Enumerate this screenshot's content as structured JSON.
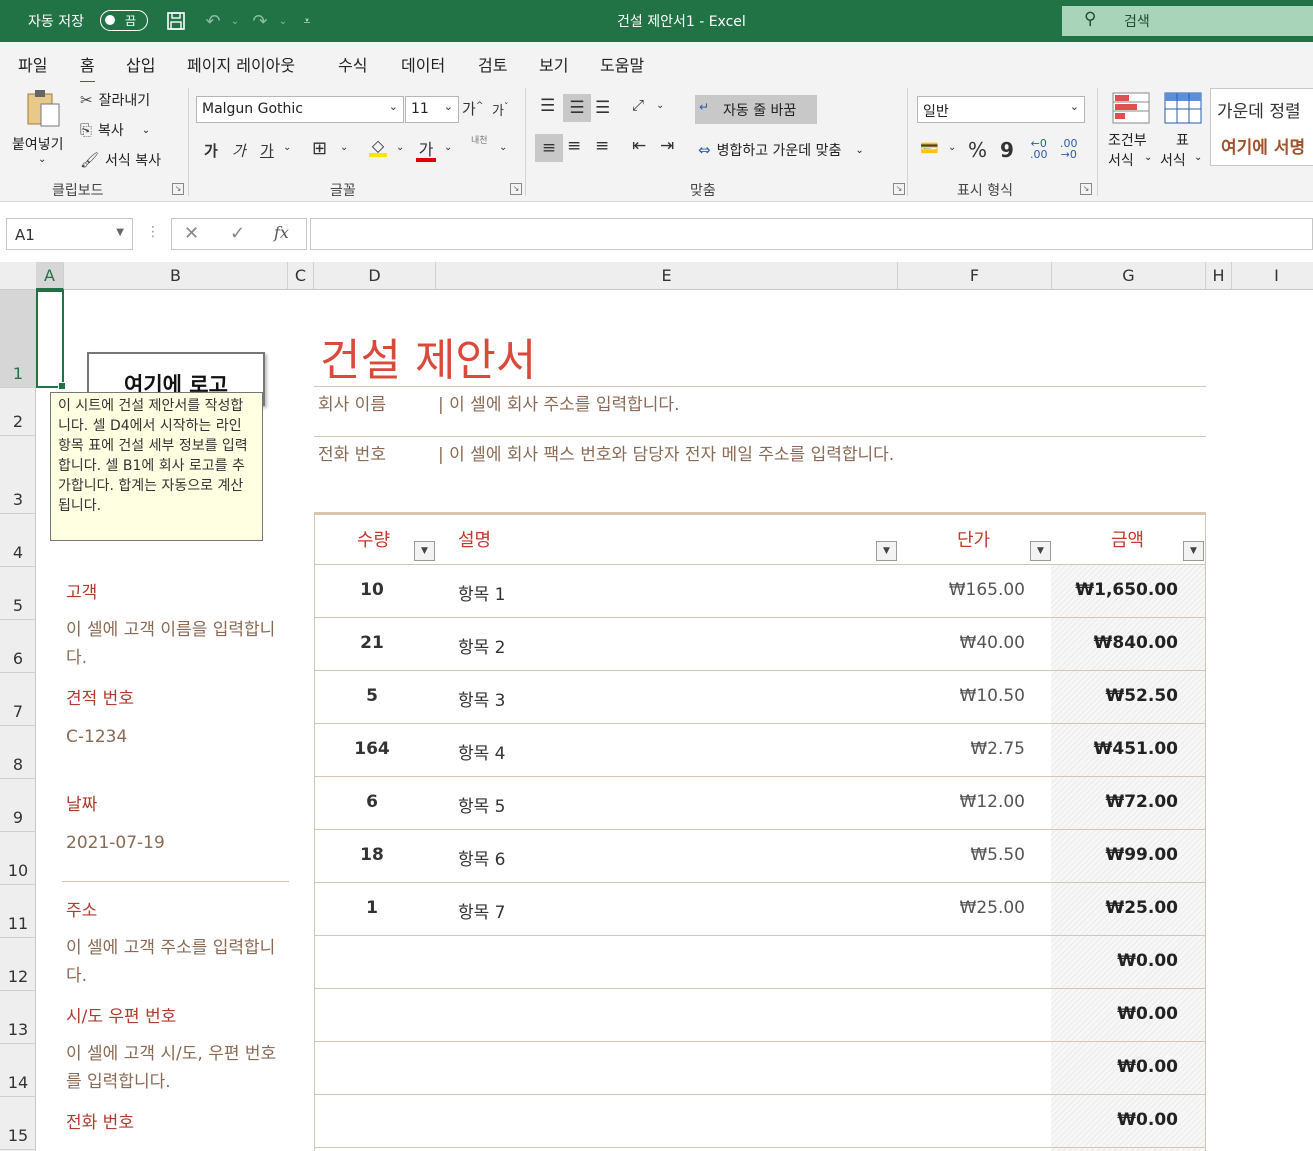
{
  "titlebar": {
    "autosave_label": "자동 저장",
    "autosave_state": "끔",
    "window_title": "건설 제안서1  -  Excel",
    "search_placeholder": "검색"
  },
  "menu": {
    "tabs": [
      "파일",
      "홈",
      "삽입",
      "페이지 레이아웃",
      "수식",
      "데이터",
      "검토",
      "보기",
      "도움말"
    ],
    "active": "홈"
  },
  "ribbon": {
    "clipboard": {
      "title": "클립보드",
      "paste": "붙여넣기",
      "cut": "잘라내기",
      "copy": "복사",
      "format_painter": "서식 복사"
    },
    "font": {
      "title": "글꼴",
      "name": "Malgun Gothic",
      "size": "11",
      "bold": "가",
      "italic": "가",
      "underline": "가",
      "grow": "가",
      "shrink": "가",
      "font_color_glyph": "가",
      "phonetic": "내천"
    },
    "alignment": {
      "title": "맞춤",
      "wrap_text": "자동 줄 바꿈",
      "merge_center": "병합하고 가운데 맞춤"
    },
    "number": {
      "title": "표시 형식",
      "format": "일반",
      "percent": "%",
      "comma": "9"
    },
    "styles": {
      "conditional": "조건부",
      "conditional2": "서식",
      "table": "표",
      "table2": "서식",
      "gallery_center": "가운데 정렬",
      "gallery_signature": "여기에 서명"
    }
  },
  "formula_bar": {
    "name_box": "A1",
    "fx": "fx",
    "value": ""
  },
  "grid": {
    "columns": [
      "A",
      "B",
      "C",
      "D",
      "E",
      "F",
      "G",
      "H",
      "I"
    ],
    "rows": [
      "1",
      "2",
      "3",
      "4",
      "5",
      "6",
      "7",
      "8",
      "9",
      "10",
      "11",
      "12",
      "13",
      "14",
      "15"
    ],
    "selected_cell": "A1"
  },
  "sheet": {
    "logo_placeholder": "여기에 로고",
    "tooltip": "이 시트에 건설 제안서를 작성합니다. 셀 D4에서 시작하는 라인 항목 표에 건설 세부 정보를 입력합니다. 셀 B1에 회사 로고를 추가합니다. 합계는 자동으로 계산됩니다.",
    "title": "건설 제안서",
    "company_label": "회사 이름",
    "company_value": "| 이 셀에 회사 주소를 입력합니다.",
    "phone_label": "전화 번호",
    "phone_value": "| 이 셀에 회사 팩스 번호와 담당자 전자 메일 주소를 입력합니다.",
    "customer_label": "고객",
    "customer_value": "이 셀에 고객 이름을 입력합니다.",
    "quote_label": "견적 번호",
    "quote_value": "C-1234",
    "date_label": "날짜",
    "date_value": "2021-07-19",
    "address_label": "주소",
    "address_value": "이 셀에 고객 주소를 입력합니다.",
    "city_label": "시/도 우편 번호",
    "city_value": "이 셀에 고객 시/도, 우편 번호를 입력합니다.",
    "cust_phone_label": "전화 번호"
  },
  "table": {
    "headers": {
      "qty": "수량",
      "desc": "설명",
      "price": "단가",
      "total": "금액"
    },
    "rows": [
      {
        "qty": "10",
        "desc": "항목 1",
        "price": "₩165.00",
        "total": "₩1,650.00"
      },
      {
        "qty": "21",
        "desc": "항목 2",
        "price": "₩40.00",
        "total": "₩840.00"
      },
      {
        "qty": "5",
        "desc": "항목 3",
        "price": "₩10.50",
        "total": "₩52.50"
      },
      {
        "qty": "164",
        "desc": "항목 4",
        "price": "₩2.75",
        "total": "₩451.00"
      },
      {
        "qty": "6",
        "desc": "항목 5",
        "price": "₩12.00",
        "total": "₩72.00"
      },
      {
        "qty": "18",
        "desc": "항목 6",
        "price": "₩5.50",
        "total": "₩99.00"
      },
      {
        "qty": "1",
        "desc": "항목 7",
        "price": "₩25.00",
        "total": "₩25.00"
      },
      {
        "qty": "",
        "desc": "",
        "price": "",
        "total": "₩0.00"
      },
      {
        "qty": "",
        "desc": "",
        "price": "",
        "total": "₩0.00"
      },
      {
        "qty": "",
        "desc": "",
        "price": "",
        "total": "₩0.00"
      },
      {
        "qty": "",
        "desc": "",
        "price": "",
        "total": "₩0.00"
      }
    ]
  },
  "colors": {
    "excel_green": "#217346",
    "title_red": "#d94a3b",
    "label_red": "#b03a2e",
    "text_brown": "#8a6a55"
  }
}
